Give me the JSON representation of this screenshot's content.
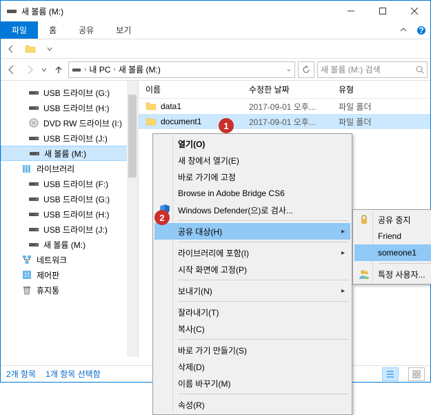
{
  "title": "새 볼륨 (M:)",
  "ribbon": {
    "file": "파일",
    "home": "홈",
    "share": "공유",
    "view": "보기"
  },
  "breadcrumb": {
    "pc": "내 PC",
    "vol": "새 볼륨 (M:)"
  },
  "search": {
    "placeholder": "새 볼륨 (M:) 검색"
  },
  "tree": {
    "items": [
      {
        "label": "USB 드라이브 (G:)",
        "icon": "drive"
      },
      {
        "label": "USB 드라이브 (H:)",
        "icon": "drive"
      },
      {
        "label": "DVD RW 드라이브 (I:)",
        "icon": "disc"
      },
      {
        "label": "USB 드라이브 (J:)",
        "icon": "drive"
      },
      {
        "label": "새 볼륨 (M:)",
        "icon": "drive",
        "selected": true
      },
      {
        "label": "라이브러리",
        "icon": "lib",
        "group": true
      },
      {
        "label": "USB 드라이브 (F:)",
        "icon": "drive"
      },
      {
        "label": "USB 드라이브 (G:)",
        "icon": "drive"
      },
      {
        "label": "USB 드라이브 (H:)",
        "icon": "drive"
      },
      {
        "label": "USB 드라이브 (J:)",
        "icon": "drive"
      },
      {
        "label": "새 볼륨 (M:)",
        "icon": "drive"
      },
      {
        "label": "네트워크",
        "icon": "network",
        "group": true
      },
      {
        "label": "제어판",
        "icon": "control",
        "group": true
      },
      {
        "label": "휴지통",
        "icon": "trash",
        "group": true
      }
    ]
  },
  "columns": {
    "name": "이름",
    "date": "수정한 날짜",
    "type": "유형"
  },
  "files": [
    {
      "name": "data1",
      "date": "2017-09-01 오후...",
      "type": "파일 폴더",
      "selected": false
    },
    {
      "name": "document1",
      "date": "2017-09-01 오후...",
      "type": "파일 폴더",
      "selected": true
    }
  ],
  "context": {
    "items": [
      {
        "label": "열기(O)",
        "bold": true
      },
      {
        "label": "새 창에서 열기(E)"
      },
      {
        "label": "바로 가기에 고정"
      },
      {
        "label": "Browse in Adobe Bridge CS6"
      },
      {
        "label": "Windows Defender(으)로 검사...",
        "icon": "shield"
      },
      {
        "sep": true
      },
      {
        "label": "공유 대상(H)",
        "sub": true,
        "highlight": true
      },
      {
        "sep": true
      },
      {
        "label": "라이브러리에 포함(I)",
        "sub": true
      },
      {
        "label": "시작 화면에 고정(P)"
      },
      {
        "sep": true
      },
      {
        "label": "보내기(N)",
        "sub": true
      },
      {
        "sep": true
      },
      {
        "label": "잘라내기(T)"
      },
      {
        "label": "복사(C)"
      },
      {
        "sep": true
      },
      {
        "label": "바로 가기 만들기(S)"
      },
      {
        "label": "삭제(D)"
      },
      {
        "label": "이름 바꾸기(M)"
      },
      {
        "sep": true
      },
      {
        "label": "속성(R)"
      }
    ]
  },
  "submenu": {
    "items": [
      {
        "label": "공유 중지",
        "icon": "lock"
      },
      {
        "label": "Friend"
      },
      {
        "label": "someone1",
        "highlight": true
      },
      {
        "sep": true
      },
      {
        "label": "특정 사용자...",
        "icon": "user"
      }
    ]
  },
  "status": {
    "count": "2개 항목",
    "selection": "1개 항목 선택함"
  },
  "badges": {
    "one": "1",
    "two": "2"
  }
}
